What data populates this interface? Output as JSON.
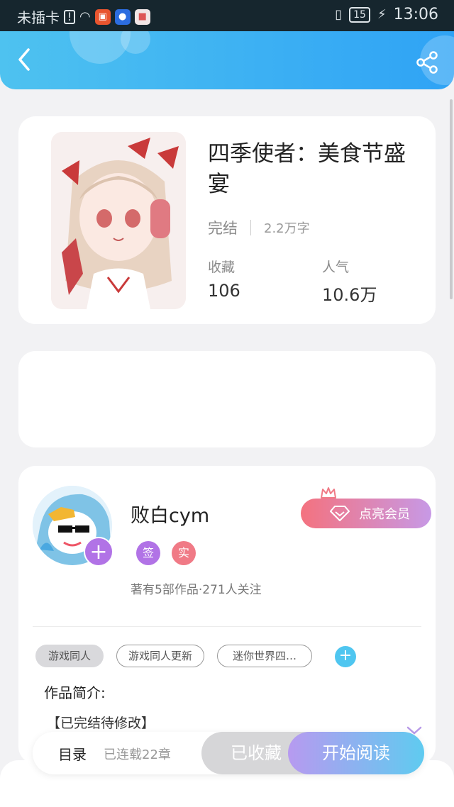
{
  "status_bar": {
    "carrier": "未插卡",
    "battery": "15",
    "time": "13:06"
  },
  "header": {
    "back_icon": "chevron-left-icon",
    "share_icon": "share-icon"
  },
  "book": {
    "title": "四季使者：美食节盛宴",
    "status": "完结",
    "word_count": "2.2万字",
    "stats": [
      {
        "label": "收藏",
        "value": "106"
      },
      {
        "label": "人气",
        "value": "10.6万"
      }
    ]
  },
  "author": {
    "name": "败白cym",
    "badges": [
      "签",
      "实"
    ],
    "meta": "著有5部作品·271人关注",
    "vip_label": "点亮会员"
  },
  "tags": [
    "游戏同人",
    "游戏同人更新",
    "迷你世界四…"
  ],
  "intro": {
    "title": "作品简介:",
    "text": "【已完结待修改】"
  },
  "bottom": {
    "toc_label": "目录",
    "serial_info": "已连载22章",
    "fav_label": "已收藏",
    "read_label": "开始阅读"
  },
  "colors": {
    "header_gradient_start": "#4ec2f0",
    "header_gradient_end": "#2fa3f5",
    "badge_sign": "#b173e6",
    "badge_real": "#f07a86",
    "read_gradient_start": "#b79af0",
    "read_gradient_end": "#5fcbf0"
  }
}
